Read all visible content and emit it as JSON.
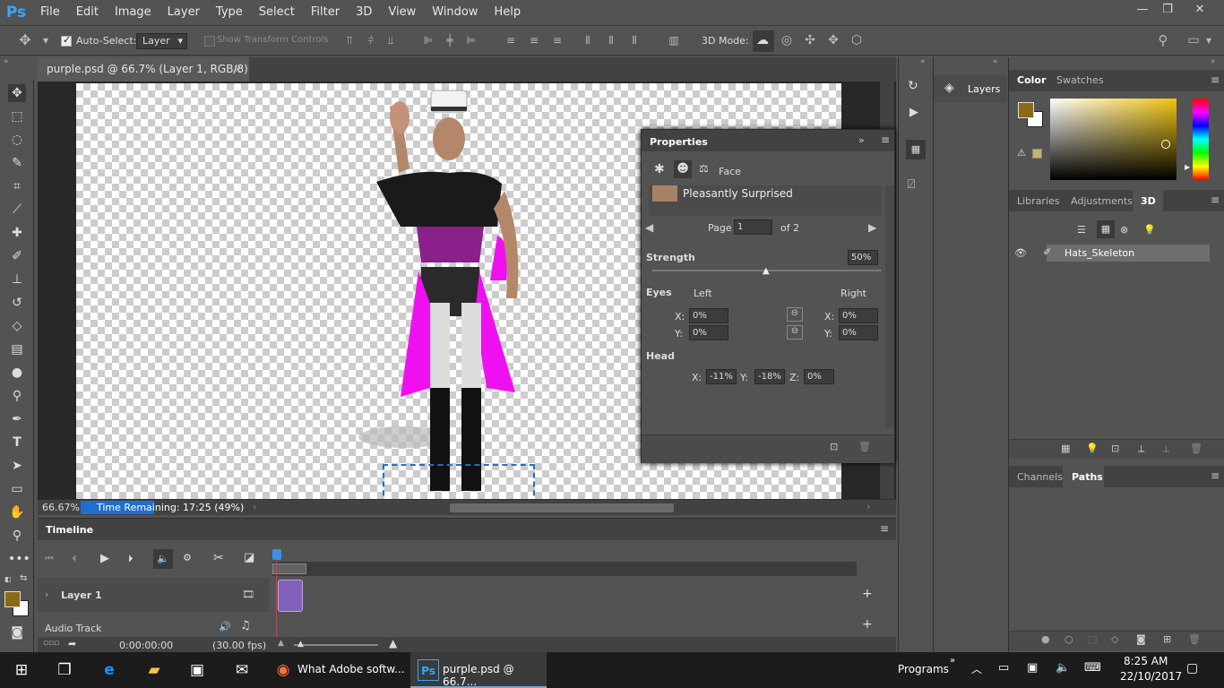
{
  "app": {
    "logo": "Ps"
  },
  "menu": [
    "File",
    "Edit",
    "Image",
    "Layer",
    "Type",
    "Select",
    "Filter",
    "3D",
    "View",
    "Window",
    "Help"
  ],
  "window_controls": {
    "minimize": "—",
    "restore": "❐",
    "close": "✕"
  },
  "options_bar": {
    "auto_select_label": "Auto-Select:",
    "auto_select_value": "Layer",
    "show_transform_label": "Show Transform Controls",
    "mode_label": "3D Mode:"
  },
  "document": {
    "tab_title": "purple.psd @ 66.7% (Layer 1, RGB/8) *",
    "zoom": "66.67%",
    "time_remaining": "Time Remaining: 17:25 (49%)"
  },
  "properties": {
    "title": "Properties",
    "section": "Face",
    "preset": "Pleasantly Surprised",
    "page_label": "Page",
    "page_value": "1",
    "page_of": "of 2",
    "strength_label": "Strength",
    "strength_value": "50%",
    "strength_level": 0.5,
    "eyes_label": "Eyes",
    "left_label": "Left",
    "right_label": "Right",
    "x_label": "X:",
    "y_label": "Y:",
    "z_label": "Z:",
    "eyes_left_x": "0%",
    "eyes_left_y": "0%",
    "eyes_right_x": "0%",
    "eyes_right_y": "0%",
    "head_label": "Head",
    "head_x": "-11%",
    "head_y": "-18%",
    "head_z": "0%"
  },
  "timeline": {
    "title": "Timeline",
    "layer_name": "Layer 1",
    "audio_track": "Audio Track",
    "timecode": "0:00:00:00",
    "fps": "(30.00 fps)"
  },
  "panels": {
    "layers_tab": "Layers",
    "color_tab": "Color",
    "swatches_tab": "Swatches",
    "libraries_tab": "Libraries",
    "adjustments_tab": "Adjustments",
    "threed_tab": "3D",
    "scene_item": "Hats_Skeleton",
    "channels_tab": "Channels",
    "paths_tab": "Paths"
  },
  "colors": {
    "foreground": "#8a6a12",
    "background": "#ffffff",
    "accent": "#1f6fd1"
  },
  "taskbar": {
    "firefox_label": "What Adobe softw...",
    "ps_label": "purple.psd @ 66.7...",
    "programs": "Programs",
    "time": "8:25 AM",
    "date": "22/10/2017"
  }
}
